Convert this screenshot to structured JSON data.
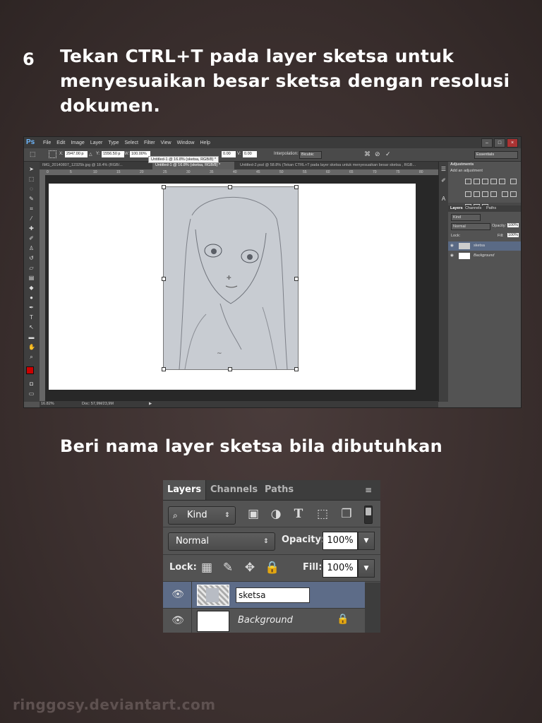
{
  "step": {
    "number": "6",
    "text": "Tekan CTRL+T pada layer sketsa untuk menyesuaikan besar sketsa dengan resolusi dokumen."
  },
  "subtitle": "Beri nama layer sketsa bila dibutuhkan",
  "watermark": "ringgosy.deviantart.com",
  "photoshop": {
    "logo": "Ps",
    "menu": [
      "File",
      "Edit",
      "Image",
      "Layer",
      "Type",
      "Select",
      "Filter",
      "View",
      "Window",
      "Help"
    ],
    "options": {
      "x_label": "X:",
      "x_value": "2947.00 p",
      "y_label": "Y:",
      "y_value": "1556.50 p",
      "w_label": "W:",
      "w_value": "100.00%",
      "h_value": "0.00",
      "v_label": "V:",
      "v_value": "0.00",
      "interpolation_label": "Interpolation:",
      "interpolation_value": "Bicubic",
      "workspace": "Essentials"
    },
    "tabs": [
      "IMG_20140807_12325b.jpg @ 18.4% (RGB/...",
      "Untitled-1 @ 16.8% (sketsa, RGB/8) *",
      "Untitled-2.psd @ 58.8% (Tekan CTRL+T pada layer sketsa untuk menyesuaikan besar sketsa , RGB..."
    ],
    "tooltip": "Untitled-1 @ 16.8% (sketsa, RGB/8) *",
    "ruler_ticks": [
      "0",
      "5",
      "10",
      "15",
      "20",
      "25",
      "30",
      "35",
      "40",
      "45",
      "50",
      "55",
      "60",
      "65",
      "70",
      "75",
      "80"
    ],
    "status": {
      "zoom": "16.82%",
      "doc": "Doc: 57,9M/23,9M"
    },
    "adjustments": {
      "title": "Adjustments",
      "subtitle": "Add an adjustment"
    },
    "mini_layers": {
      "tabs": [
        "Layers",
        "Channels",
        "Paths"
      ],
      "kind": "Kind",
      "blend": "Normal",
      "opacity_label": "Opacity:",
      "opacity_value": "100%",
      "lock_label": "Lock:",
      "fill_label": "Fill:",
      "fill_value": "100%",
      "layers": [
        "sketsa",
        "Background"
      ]
    }
  },
  "layers_panel": {
    "tabs": [
      "Layers",
      "Channels",
      "Paths"
    ],
    "kind_label": "Kind",
    "blend_mode": "Normal",
    "opacity_label": "Opacity:",
    "opacity_value": "100%",
    "lock_label": "Lock:",
    "fill_label": "Fill:",
    "fill_value": "100%",
    "layers": [
      {
        "name": "sketsa",
        "selected": true,
        "editing": true
      },
      {
        "name": "Background",
        "selected": false,
        "locked": true
      }
    ]
  }
}
